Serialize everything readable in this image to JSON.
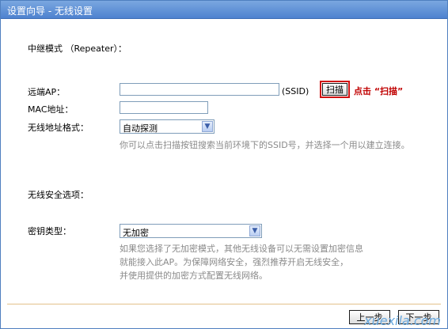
{
  "window": {
    "title": "设置向导 - 无线设置"
  },
  "section": {
    "repeater_mode": "中继模式 （Repeater）："
  },
  "fields": {
    "remote_ap_label": "远端AP：",
    "ssid_suffix": "(SSID)",
    "scan_button": "扫描",
    "scan_hint": "点击 “扫描”",
    "mac_label": "MAC地址：",
    "addr_format_label": "无线地址格式：",
    "addr_format_value": "自动探测",
    "addr_format_hint": "你可以点击扫描按钮搜索当前环境下的SSID号，并选择一个用以建立连接。",
    "security_label": "无线安全选项：",
    "key_type_label": "密钥类型：",
    "key_type_value": "无加密",
    "key_type_hint_1": "如果您选择了无加密模式，其他无线设备可以无需设置加密信息",
    "key_type_hint_2": "就能接入此AP。为保障网络安全，强烈推荐开启无线安全，",
    "key_type_hint_3": "并使用提供的加密方式配置无线网络。"
  },
  "buttons": {
    "prev": "上一步",
    "next": "下一步"
  },
  "watermark": "xuexila.com"
}
